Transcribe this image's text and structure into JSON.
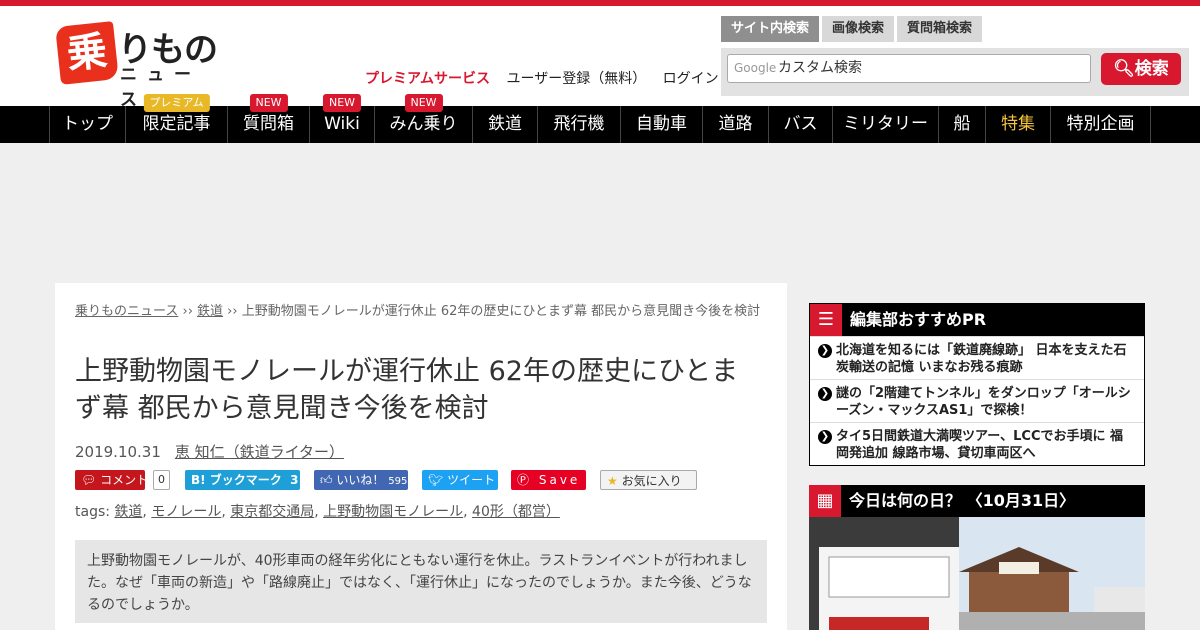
{
  "header": {
    "logo_mark": "乗",
    "logo_text": "りもの",
    "logo_sub": "ニュース",
    "premium_link": "プレミアムサービス",
    "register_link": "ユーザー登録（無料）",
    "login_link": "ログイン"
  },
  "search": {
    "tabs": [
      "サイト内検索",
      "画像検索",
      "質問箱検索"
    ],
    "google_label": "Google",
    "placeholder": "カスタム検索",
    "button_label": "検索"
  },
  "nav": {
    "items": [
      {
        "label": "トップ",
        "badge": ""
      },
      {
        "label": "限定記事",
        "badge": "プレミアム"
      },
      {
        "label": "質問箱",
        "badge": "NEW"
      },
      {
        "label": "Wiki",
        "badge": "NEW"
      },
      {
        "label": "みん乗り",
        "badge": "NEW"
      },
      {
        "label": "鉄道",
        "badge": ""
      },
      {
        "label": "飛行機",
        "badge": ""
      },
      {
        "label": "自動車",
        "badge": ""
      },
      {
        "label": "道路",
        "badge": ""
      },
      {
        "label": "バス",
        "badge": ""
      },
      {
        "label": "ミリタリー",
        "badge": ""
      },
      {
        "label": "船",
        "badge": ""
      },
      {
        "label": "特集",
        "badge": ""
      },
      {
        "label": "特別企画",
        "badge": ""
      }
    ]
  },
  "article": {
    "breadcrumb": {
      "home": "乗りものニュース",
      "sep1": " ›› ",
      "category": "鉄道",
      "sep2": " ›› ",
      "current": "上野動物園モノレールが運行休止 62年の歴史にひとまず幕 都民から意見聞き今後を検討"
    },
    "title": "上野動物園モノレールが運行休止 62年の歴史にひとまず幕 都民から意見聞き今後を検討",
    "date": "2019.10.31",
    "author": "恵 知仁（鉄道ライター）",
    "social": {
      "comment_label": "コメント",
      "comment_count": "0",
      "hatena_label": "B! ブックマーク",
      "hatena_count": "3",
      "like_label": "いいね！",
      "like_count": "595",
      "tweet_label": "ツイート",
      "pin_label": "Save",
      "fav_label": "お気に入り"
    },
    "tags_prefix": "tags: ",
    "tags": [
      "鉄道",
      "モノレール",
      "東京都交通局",
      "上野動物園モノレール",
      "40形（都営）"
    ],
    "summary": "上野動物園モノレールが、40形車両の経年劣化にともない運行を休止。ラストランイベントが行われました。なぜ「車両の新造」や「路線廃止」ではなく、「運行休止」になったのでしょうか。また今後、どうなるのでしょうか。"
  },
  "sidebar": {
    "recommend_title": "編集部おすすめPR",
    "recommend_items": [
      "北海道を知るには「鉄道廃線跡」 日本を支えた石炭輸送の記憶 いまなお残る痕跡",
      "謎の「2階建てトンネル」をダンロップ「オールシーズン・マックスAS1」で探検！",
      "タイ5日間鉄道大満喫ツアー、LCCでお手頃に 福岡発追加 線路市場、貸切車両区へ"
    ],
    "today_title": "今日は何の日？ 〈10月31日〉"
  },
  "colors": {
    "brand_red": "#d7182f",
    "nav_bg": "#000000",
    "special_nav": "#f5c33b"
  }
}
